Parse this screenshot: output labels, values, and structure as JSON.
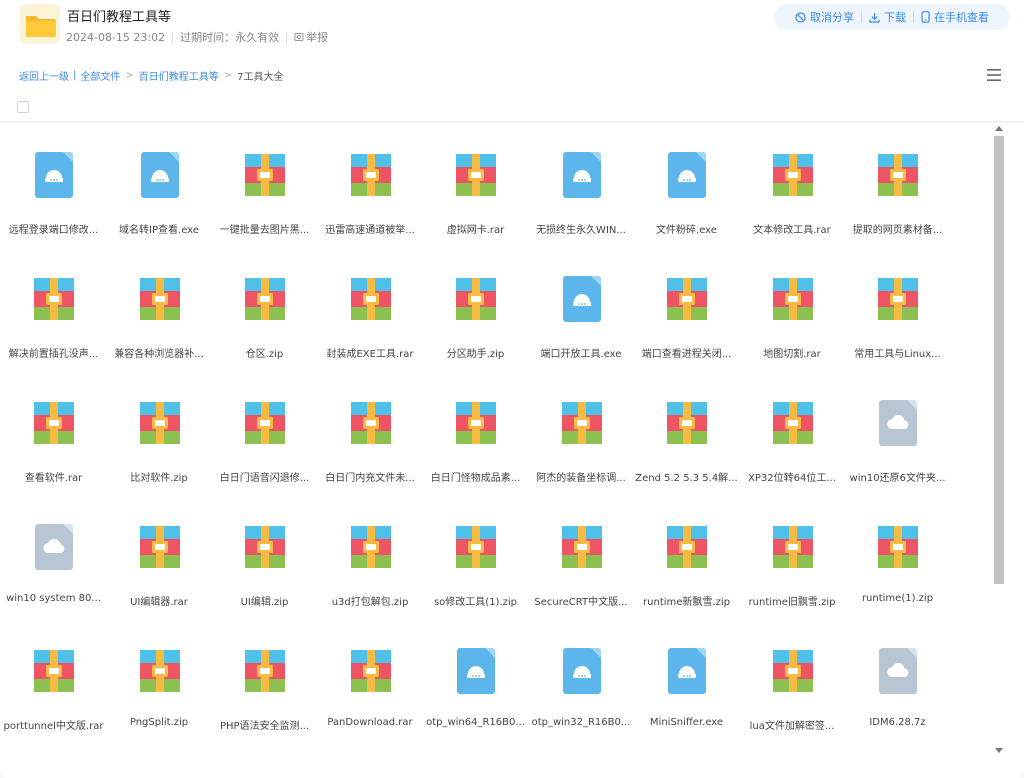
{
  "share": {
    "title": "百日们教程工具等",
    "date": "2024-08-15 23:02",
    "expiry": "过期时间：永久有效",
    "report_label": "举报"
  },
  "actions": {
    "cancel_share": "取消分享",
    "download": "下载",
    "view_on_phone": "在手机查看"
  },
  "breadcrumb": {
    "back": "返回上一级",
    "all_files": "全部文件",
    "parent": "百日们教程工具等",
    "current": "7工具大全"
  },
  "colors": {
    "accent": "#3b8cea",
    "exe_icon": "#5cb6ec",
    "cloud_icon": "#b8c6d4"
  },
  "files": [
    {
      "name": "远程登录端口修改...",
      "type": "exe"
    },
    {
      "name": "域名转IP查看.exe",
      "type": "exe"
    },
    {
      "name": "一键批量去图片黑...",
      "type": "archive"
    },
    {
      "name": "迅雷高速通道被举...",
      "type": "archive"
    },
    {
      "name": "虚拟网卡.rar",
      "type": "archive"
    },
    {
      "name": "无损终生永久WIN...",
      "type": "exe"
    },
    {
      "name": "文件粉碎.exe",
      "type": "exe"
    },
    {
      "name": "文本修改工具.rar",
      "type": "archive"
    },
    {
      "name": "提取的网页素材备...",
      "type": "archive"
    },
    {
      "name": "解决前置插孔没声...",
      "type": "archive"
    },
    {
      "name": "兼容各种浏览器补...",
      "type": "archive"
    },
    {
      "name": "仓区.zip",
      "type": "archive"
    },
    {
      "name": "封装成EXE工具.rar",
      "type": "archive"
    },
    {
      "name": "分区助手.zip",
      "type": "archive"
    },
    {
      "name": "端口开放工具.exe",
      "type": "exe"
    },
    {
      "name": "端口查看进程关闭...",
      "type": "archive"
    },
    {
      "name": "地图切割.rar",
      "type": "archive"
    },
    {
      "name": "常用工具与Linux...",
      "type": "archive"
    },
    {
      "name": "查看软件.rar",
      "type": "archive"
    },
    {
      "name": "比对软件.zip",
      "type": "archive"
    },
    {
      "name": "白日门语音闪退修...",
      "type": "archive"
    },
    {
      "name": "白日门内充文件未...",
      "type": "archive"
    },
    {
      "name": "白日门怪物成品素...",
      "type": "archive"
    },
    {
      "name": "阿杰的装备坐标调...",
      "type": "archive"
    },
    {
      "name": "Zend 5.2 5.3 5.4解...",
      "type": "archive"
    },
    {
      "name": "XP32位转64位工...",
      "type": "archive"
    },
    {
      "name": "win10还原6文件夹...",
      "type": "cloud"
    },
    {
      "name": "win10 system 80...",
      "type": "cloud"
    },
    {
      "name": "UI编辑器.rar",
      "type": "archive"
    },
    {
      "name": "UI编辑.zip",
      "type": "archive"
    },
    {
      "name": "u3d打包解包.zip",
      "type": "archive"
    },
    {
      "name": "so修改工具(1).zip",
      "type": "archive"
    },
    {
      "name": "SecureCRT中文版...",
      "type": "archive"
    },
    {
      "name": "runtime新飘雪.zip",
      "type": "archive"
    },
    {
      "name": "runtime旧飘雪.zip",
      "type": "archive"
    },
    {
      "name": "runtime(1).zip",
      "type": "archive"
    },
    {
      "name": "porttunnel中文版.rar",
      "type": "archive"
    },
    {
      "name": "PngSplit.zip",
      "type": "archive"
    },
    {
      "name": "PHP语法安全监测...",
      "type": "archive"
    },
    {
      "name": "PanDownload.rar",
      "type": "archive"
    },
    {
      "name": "otp_win64_R16B0...",
      "type": "exe"
    },
    {
      "name": "otp_win32_R16B0...",
      "type": "exe"
    },
    {
      "name": "MiniSniffer.exe",
      "type": "exe"
    },
    {
      "name": "lua文件加解密签...",
      "type": "archive"
    },
    {
      "name": "IDM6.28.7z",
      "type": "cloud"
    }
  ]
}
